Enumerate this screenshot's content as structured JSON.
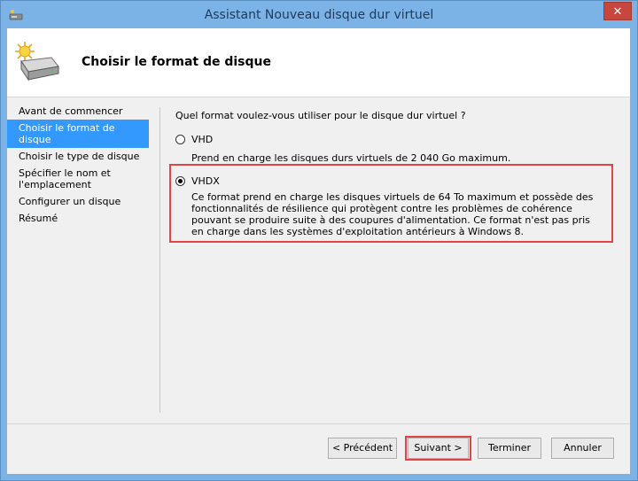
{
  "window": {
    "title": "Assistant Nouveau disque dur virtuel",
    "close_label": "✕"
  },
  "header": {
    "title": "Choisir le format de disque"
  },
  "nav": {
    "items": [
      {
        "label": "Avant de commencer",
        "active": false
      },
      {
        "label": "Choisir le format de disque",
        "active": true
      },
      {
        "label": "Choisir le type de disque",
        "active": false
      },
      {
        "label": "Spécifier le nom et l'emplacement",
        "active": false
      },
      {
        "label": "Configurer un disque",
        "active": false
      },
      {
        "label": "Résumé",
        "active": false
      }
    ]
  },
  "content": {
    "question": "Quel format voulez-vous utiliser pour le disque dur virtuel ?",
    "options": [
      {
        "label": "VHD",
        "description": "Prend en charge les disques durs virtuels de 2 040 Go maximum.",
        "selected": false
      },
      {
        "label": "VHDX",
        "description": "Ce format prend en charge les disques virtuels de 64 To maximum et possède des fonctionnalités de résilience qui protègent contre les problèmes de cohérence pouvant se produire suite à des coupures d'alimentation. Ce format n'est pas pris en charge dans les systèmes d'exploitation antérieurs à Windows 8.",
        "selected": true
      }
    ]
  },
  "buttons": {
    "previous": "< Précédent",
    "next": "Suivant >",
    "finish": "Terminer",
    "cancel": "Annuler"
  },
  "colors": {
    "title_bar": "#7cb3e6",
    "close_button": "#c7473f",
    "nav_active": "#3399ff",
    "highlight_box": "#e04444"
  }
}
